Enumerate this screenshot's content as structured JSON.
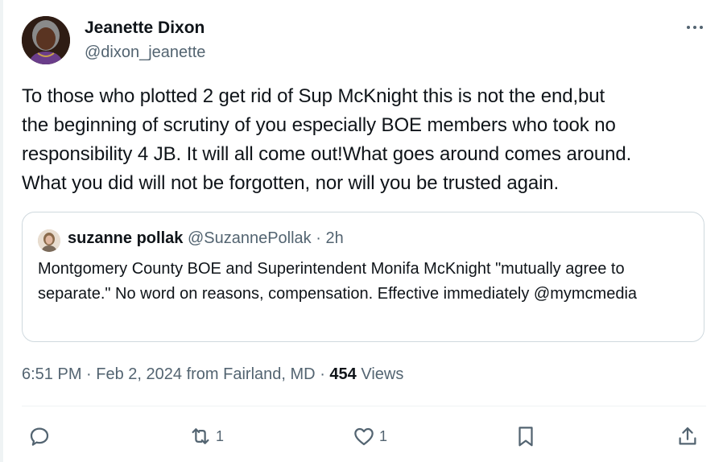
{
  "author": {
    "name": "Jeanette Dixon",
    "handle": "@dixon_jeanette"
  },
  "tweet": {
    "text": "To those who plotted 2 get rid of Sup McKnight this is not the end,but\nthe beginning of scrutiny of  you especially BOE members who took no\nresponsibility 4 JB. It will all come out!What goes around comes around.\nWhat you did will not be forgotten, nor will you  be trusted again."
  },
  "quoted_tweet": {
    "name": "suzanne pollak",
    "handle": "@SuzannePollak",
    "separator": "·",
    "time": "2h",
    "text": "Montgomery County BOE and Superintendent Monifa McKnight \"mutually agree to separate.\" No word on reasons, compensation. Effective immediately @mymcmedia"
  },
  "meta": {
    "time": "6:51 PM",
    "date": "Feb 2, 2024",
    "location": "from Fairland, MD",
    "separator": "·",
    "views_count": "454",
    "views_label": "Views"
  },
  "actions": {
    "reply_count": "",
    "retweet_count": "1",
    "like_count": "1"
  },
  "icons": [
    "more-icon",
    "reply-icon",
    "retweet-icon",
    "like-icon",
    "bookmark-icon",
    "share-icon"
  ],
  "colors": {
    "text": "#0f1419",
    "secondary": "#536471",
    "border": "#cfd9de"
  }
}
